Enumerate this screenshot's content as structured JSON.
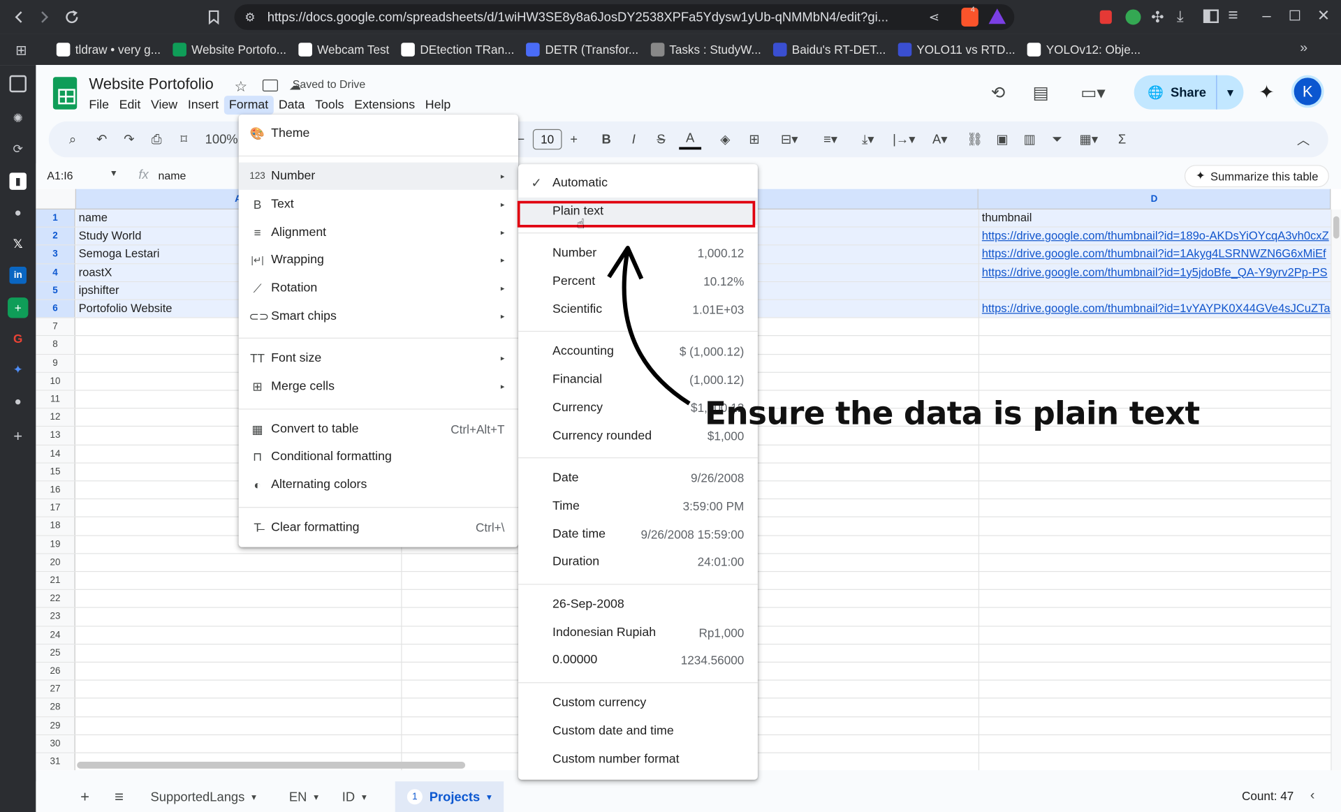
{
  "browser": {
    "url": "https://docs.google.com/spreadsheets/d/1wiHW3SE8y8a6JosDY2538XPFa5Ydysw1yUb-qNMMbN4/edit?gi...",
    "bookmarks": [
      {
        "label": "tldraw • very g...",
        "color": "#ffffff"
      },
      {
        "label": "Website Portofo...",
        "color": "#0f9d58"
      },
      {
        "label": "Webcam Test",
        "color": "#ffffff"
      },
      {
        "label": "DEtection TRan...",
        "color": "#ffffff"
      },
      {
        "label": "DETR (Transfor...",
        "color": "#4a6cf7"
      },
      {
        "label": "Tasks : StudyW...",
        "color": "#888888"
      },
      {
        "label": "Baidu's RT-DET...",
        "color": "#3a4fd1"
      },
      {
        "label": "YOLO11 vs RTD...",
        "color": "#3a4fd1"
      },
      {
        "label": "YOLOv12: Obje...",
        "color": "#ffffff"
      }
    ],
    "ext_badge": "4"
  },
  "doc": {
    "title": "Website Portofolio",
    "saved_status": "Saved to Drive",
    "menu": [
      "File",
      "Edit",
      "View",
      "Insert",
      "Format",
      "Data",
      "Tools",
      "Extensions",
      "Help"
    ],
    "share_label": "Share",
    "avatar_letter": "K"
  },
  "toolbar": {
    "zoom": "100%",
    "font_size": "10"
  },
  "formula_bar": {
    "name_box": "A1:I6",
    "fx": "fx",
    "value": "name",
    "summarize": "Summarize this table"
  },
  "grid": {
    "col_a": "A",
    "col_d": "D",
    "row_numbers": [
      "1",
      "2",
      "3",
      "4",
      "5",
      "6",
      "7",
      "8",
      "9",
      "10",
      "11",
      "12",
      "13",
      "14",
      "15",
      "16",
      "17",
      "18",
      "19",
      "20",
      "21",
      "22",
      "23",
      "24",
      "25",
      "26",
      "27",
      "28",
      "29",
      "30",
      "31"
    ],
    "rows": [
      {
        "a": "name",
        "d": "thumbnail",
        "d_link": false
      },
      {
        "a": "Study World",
        "d": "https://drive.google.com/thumbnail?id=189o-AKDsYiOYcqA3vh0cxZ",
        "d_link": true
      },
      {
        "a": "Semoga Lestari",
        "d": "https://drive.google.com/thumbnail?id=1Akyg4LSRNWZN6G6xMiEf",
        "d_link": true
      },
      {
        "a": "roastX",
        "d": "https://drive.google.com/thumbnail?id=1y5jdoBfe_QA-Y9yrv2Pp-PS",
        "d_link": true
      },
      {
        "a": "ipshifter",
        "d": "",
        "d_link": false
      },
      {
        "a": "Portofolio Website",
        "d": "https://drive.google.com/thumbnail?id=1vYAYPK0X44GVe4sJCuZTa",
        "d_link": true
      }
    ]
  },
  "format_menu": {
    "items": [
      {
        "icon": "palette-icon",
        "glyph": "🎨",
        "label": "Theme",
        "arrow": false,
        "shortcut": ""
      },
      {
        "icon": "number-icon",
        "glyph": "123",
        "label": "Number",
        "arrow": true,
        "shortcut": ""
      },
      {
        "icon": "bold-icon",
        "glyph": "B",
        "label": "Text",
        "arrow": true,
        "shortcut": ""
      },
      {
        "icon": "align-icon",
        "glyph": "≡",
        "label": "Alignment",
        "arrow": true,
        "shortcut": ""
      },
      {
        "icon": "wrap-icon",
        "glyph": "|↵|",
        "label": "Wrapping",
        "arrow": true,
        "shortcut": ""
      },
      {
        "icon": "rotate-icon",
        "glyph": "⟋",
        "label": "Rotation",
        "arrow": true,
        "shortcut": ""
      },
      {
        "icon": "chip-icon",
        "glyph": "⊂⊃",
        "label": "Smart chips",
        "arrow": true,
        "shortcut": ""
      },
      {
        "icon": "font-size-icon",
        "glyph": "TT",
        "label": "Font size",
        "arrow": true,
        "shortcut": ""
      },
      {
        "icon": "merge-icon",
        "glyph": "⊞",
        "label": "Merge cells",
        "arrow": true,
        "shortcut": ""
      },
      {
        "icon": "table-icon",
        "glyph": "▦",
        "label": "Convert to table",
        "arrow": false,
        "shortcut": "Ctrl+Alt+T"
      },
      {
        "icon": "paint-roller-icon",
        "glyph": "⊓",
        "label": "Conditional formatting",
        "arrow": false,
        "shortcut": ""
      },
      {
        "icon": "droplet-icon",
        "glyph": "◐",
        "label": "Alternating colors",
        "arrow": false,
        "shortcut": ""
      },
      {
        "icon": "clear-format-icon",
        "glyph": "T̶",
        "label": "Clear formatting",
        "arrow": false,
        "shortcut": "Ctrl+\\"
      }
    ]
  },
  "number_menu": {
    "items": [
      {
        "label": "Automatic",
        "example": "",
        "checked": true
      },
      {
        "label": "Plain text",
        "example": "",
        "checked": false
      },
      {
        "label": "Number",
        "example": "1,000.12",
        "checked": false
      },
      {
        "label": "Percent",
        "example": "10.12%",
        "checked": false
      },
      {
        "label": "Scientific",
        "example": "1.01E+03",
        "checked": false
      },
      {
        "label": "Accounting",
        "example": "$ (1,000.12)",
        "checked": false
      },
      {
        "label": "Financial",
        "example": "(1,000.12)",
        "checked": false
      },
      {
        "label": "Currency",
        "example": "$1,000.12",
        "checked": false
      },
      {
        "label": "Currency rounded",
        "example": "$1,000",
        "checked": false
      },
      {
        "label": "Date",
        "example": "9/26/2008",
        "checked": false
      },
      {
        "label": "Time",
        "example": "3:59:00 PM",
        "checked": false
      },
      {
        "label": "Date time",
        "example": "9/26/2008 15:59:00",
        "checked": false
      },
      {
        "label": "Duration",
        "example": "24:01:00",
        "checked": false
      },
      {
        "label": "26-Sep-2008",
        "example": "",
        "checked": false
      },
      {
        "label": "Indonesian Rupiah",
        "example": "Rp1,000",
        "checked": false
      },
      {
        "label": "0.00000",
        "example": "1234.56000",
        "checked": false
      },
      {
        "label": "Custom currency",
        "example": "",
        "checked": false
      },
      {
        "label": "Custom date and time",
        "example": "",
        "checked": false
      },
      {
        "label": "Custom number format",
        "example": "",
        "checked": false
      }
    ]
  },
  "annotation": {
    "text": "Ensure the data is plain text",
    "highlight_color": "#e0000f"
  },
  "sheet_tabs": [
    {
      "label": "SupportedLangs",
      "badge": "",
      "active": false
    },
    {
      "label": "EN",
      "badge": "",
      "active": false
    },
    {
      "label": "ID",
      "badge": "",
      "active": false
    },
    {
      "label": "Projects",
      "badge": "1",
      "active": true
    }
  ],
  "status": {
    "count": "Count: 47"
  }
}
